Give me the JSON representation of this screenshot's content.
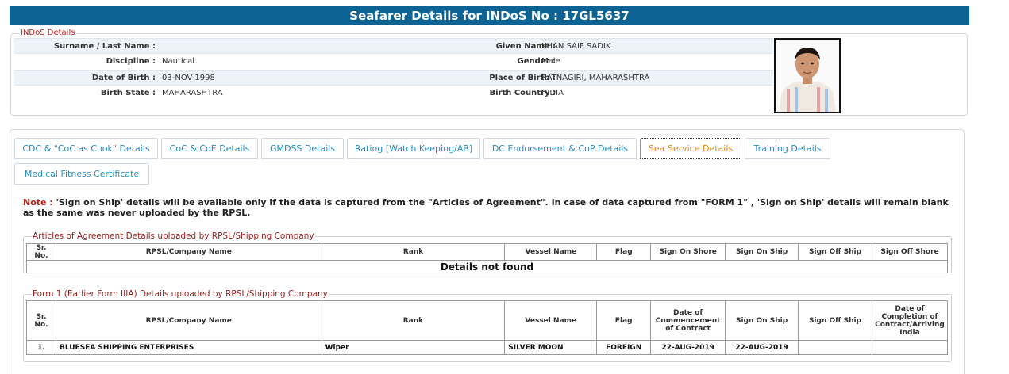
{
  "page": {
    "title": "Seafarer Details for INDoS No : 17GL5637"
  },
  "indos": {
    "legend": "INDoS Details",
    "rows": [
      {
        "l1": "Surname / Last Name :",
        "v1": "",
        "l2": "Given Name :",
        "v2": "KHAN SAIF SADIK"
      },
      {
        "l1": "Discipline :",
        "v1": "Nautical",
        "l2": "Gender :",
        "v2": "Male"
      },
      {
        "l1": "Date of Birth :",
        "v1": "03-NOV-1998",
        "l2": "Place of Birth :",
        "v2": "RATNAGIRI, MAHARASHTRA"
      },
      {
        "l1": "Birth State :",
        "v1": "MAHARASHTRA",
        "l2": "Birth Country :",
        "v2": "INDIA"
      }
    ]
  },
  "tabs": [
    "CDC & \"CoC as Cook\" Details",
    "CoC & CoE Details",
    "GMDSS Details",
    "Rating [Watch Keeping/AB]",
    "DC Endorsement & CoP Details",
    "Sea Service Details",
    "Training Details",
    "Medical Fitness Certificate"
  ],
  "active_tab": "Sea Service Details",
  "note": {
    "label": "Note :",
    "text": " 'Sign on Ship' details will be available only if the data is captured from the \"Articles of Agreement\". In case of data captured from \"FORM 1\" , 'Sign on Ship' details will remain blank as the same was never uploaded by the RPSL."
  },
  "articles": {
    "legend": "Articles of Agreement Details uploaded by RPSL/Shipping Company",
    "headers": [
      "Sr. No.",
      "RPSL/Company Name",
      "Rank",
      "Vessel Name",
      "Flag",
      "Sign On Shore",
      "Sign On Ship",
      "Sign Off Ship",
      "Sign Off Shore"
    ],
    "empty_message": "Details not found"
  },
  "form1": {
    "legend": "Form 1 (Earlier Form IIIA) Details uploaded by RPSL/Shipping Company",
    "headers": [
      "Sr. No.",
      "RPSL/Company Name",
      "Rank",
      "Vessel Name",
      "Flag",
      "Date of Commencement of Contract",
      "Sign On Ship",
      "Sign Off Ship",
      "Date of Completion of Contract/Arriving India"
    ],
    "rows": [
      {
        "sr": "1.",
        "company": "BLUESEA SHIPPING ENTERPRISES",
        "rank": "Wiper",
        "vessel": "SILVER MOON",
        "flag": "FOREIGN",
        "commencement": "22-AUG-2019",
        "sign_on_ship": "22-AUG-2019",
        "sign_off_ship": "",
        "completion": ""
      }
    ]
  },
  "colors": {
    "header_bg": "#0c6394",
    "tab_text": "#2a8bbd",
    "active_tab": "#e08b12",
    "note_label": "#c0211f",
    "legend": "#9b1c1c"
  }
}
